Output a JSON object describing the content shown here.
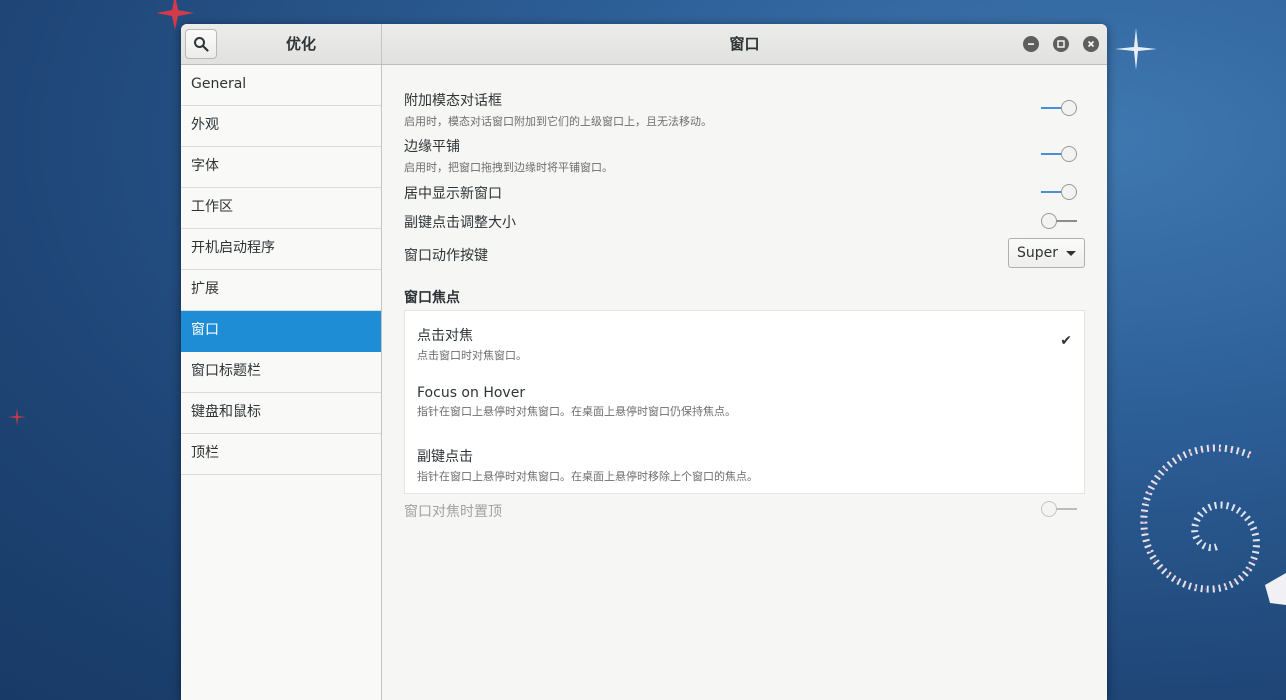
{
  "window": {
    "sidebar_title": "优化",
    "title": "窗口"
  },
  "sidebar": {
    "items": [
      {
        "label": "General"
      },
      {
        "label": "外观"
      },
      {
        "label": "字体"
      },
      {
        "label": "工作区"
      },
      {
        "label": "开机启动程序"
      },
      {
        "label": "扩展"
      },
      {
        "label": "窗口",
        "active": true
      },
      {
        "label": "窗口标题栏"
      },
      {
        "label": "键盘和鼠标"
      },
      {
        "label": "顶栏"
      }
    ]
  },
  "settings": {
    "attach_modal": {
      "title": "附加模态对话框",
      "desc": "启用时，模态对话窗口附加到它们的上级窗口上，且无法移动。",
      "enabled": true
    },
    "edge_tiling": {
      "title": "边缘平铺",
      "desc": "启用时，把窗口拖拽到边缘时将平铺窗口。",
      "enabled": true
    },
    "center_new": {
      "title": "居中显示新窗口",
      "enabled": true
    },
    "resize_secondary": {
      "title": "副键点击调整大小",
      "enabled": false
    },
    "action_key": {
      "title": "窗口动作按键",
      "value": "Super"
    }
  },
  "focus": {
    "section_title": "窗口焦点",
    "options": [
      {
        "title": "点击对焦",
        "desc": "点击窗口时对焦窗口。",
        "selected": true
      },
      {
        "title": "Focus on Hover",
        "desc": "指针在窗口上悬停时对焦窗口。在桌面上悬停时窗口仍保持焦点。",
        "selected": false
      },
      {
        "title": "副键点击",
        "desc": "指针在窗口上悬停时对焦窗口。在桌面上悬停时移除上个窗口的焦点。",
        "selected": false
      }
    ],
    "check_glyph": "✔",
    "raise_on_focus": {
      "title": "窗口对焦时置顶",
      "enabled": false,
      "disabled": true
    }
  },
  "colors": {
    "accent": "#1f8dd6",
    "switch_on": "#4a90d9"
  }
}
